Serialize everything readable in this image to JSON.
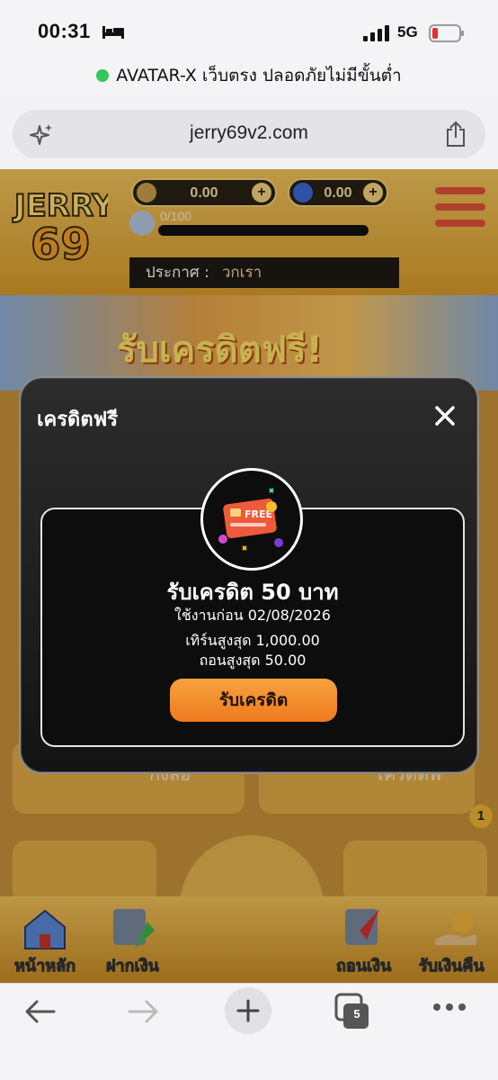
{
  "status_bar": {
    "time": "00:31",
    "network": "5G"
  },
  "browser": {
    "page_title": "AVATAR-X เว็บตรง ปลอดภัยไม่มีขั้นต่ำ",
    "url": "jerry69v2.com",
    "tab_count": "5"
  },
  "site": {
    "balance_credit": "0.00",
    "balance_gems": "0.00",
    "xp": "0/100",
    "announcement_label": "ประกาศ :",
    "announcement_text": "วกเรา",
    "banner_text": "รับเครดิตฟรี!",
    "tiles": [
      "กงล้อ",
      "เครดิตฟ"
    ],
    "chat_badge": "1",
    "nav": [
      "หน้าหลัก",
      "ฝากเงิน",
      "ถอนเงิน",
      "รับเงินคืน"
    ]
  },
  "modal": {
    "title": "เครดิตฟรี",
    "card_title": "รับเครดิต 50 บาท",
    "use_before": "ใช้งานก่อน 02/08/2026",
    "max_turnover": "เทิร์นสูงสุด 1,000.00",
    "max_withdraw": "ถอนสูงสุด 50.00",
    "claim_button": "รับเครดิต",
    "coupon_label": "FREE"
  },
  "colors": {
    "accent": "#ee7a1f",
    "modal_bg": "#1a1a1a",
    "site_bg": "#d99c2c"
  }
}
